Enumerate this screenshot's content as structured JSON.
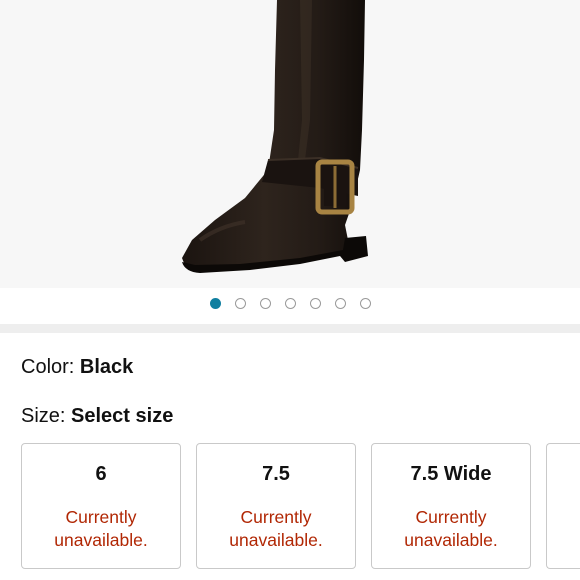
{
  "gallery": {
    "image_count": 7,
    "active_index": 0,
    "accent_color": "#107fa0"
  },
  "color": {
    "label": "Color:",
    "value": "Black"
  },
  "size": {
    "label": "Size:",
    "value": "Select size",
    "options": [
      {
        "value": "6",
        "status_line1": "Currently",
        "status_line2": "unavailable."
      },
      {
        "value": "7.5",
        "status_line1": "Currently",
        "status_line2": "unavailable."
      },
      {
        "value": "7.5 Wide",
        "status_line1": "Currently",
        "status_line2": "unavailable."
      }
    ]
  },
  "status_color": "#b12704"
}
